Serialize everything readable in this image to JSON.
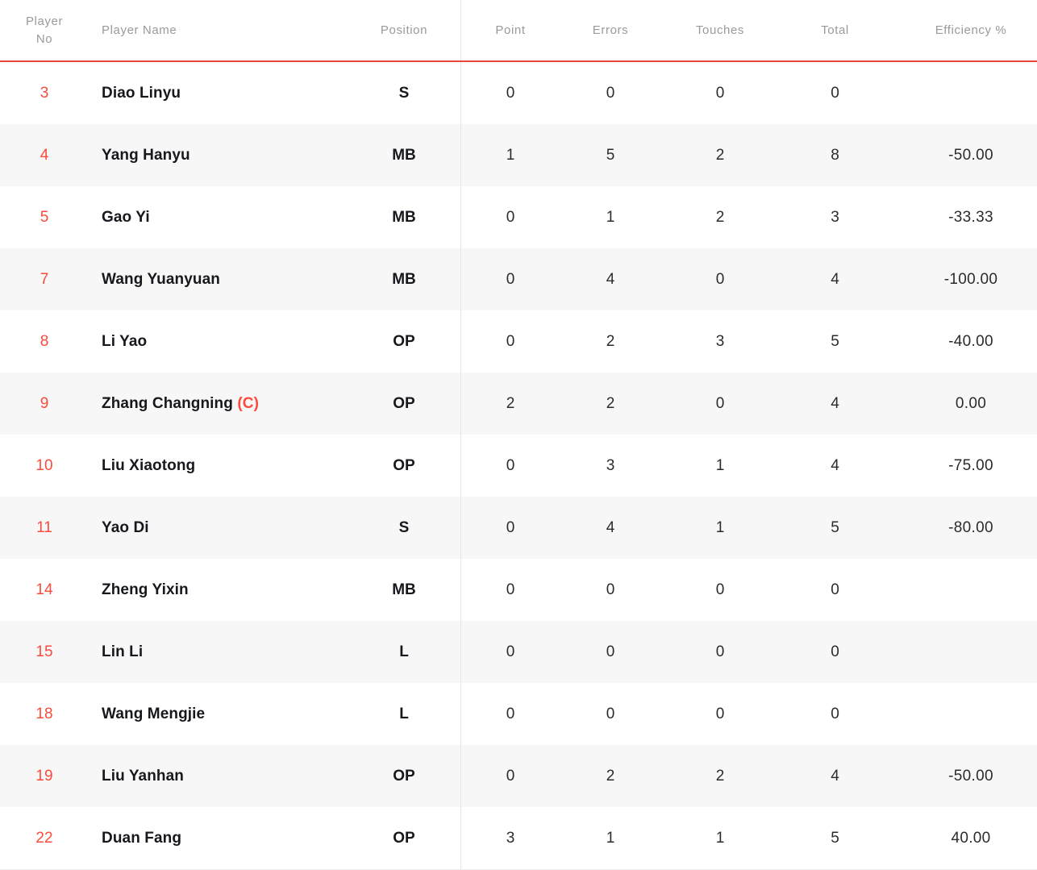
{
  "table": {
    "columns": [
      {
        "key": "player_no",
        "label": "Player No",
        "label_line1": "Player",
        "label_line2": "No"
      },
      {
        "key": "name",
        "label": "Player Name"
      },
      {
        "key": "position",
        "label": "Position"
      },
      {
        "key": "point",
        "label": "Point"
      },
      {
        "key": "errors",
        "label": "Errors"
      },
      {
        "key": "touches",
        "label": "Touches"
      },
      {
        "key": "total",
        "label": "Total"
      },
      {
        "key": "efficiency",
        "label": "Efficiency %"
      }
    ],
    "captain_marker": "(C)",
    "accent_color": "#fb4b3c",
    "header_rule_color": "#e8453c",
    "stripe_color": "#f7f7f7",
    "rows": [
      {
        "player_no": "3",
        "name": "Diao Linyu",
        "captain": "",
        "position": "S",
        "point": "0",
        "errors": "0",
        "touches": "0",
        "total": "0",
        "efficiency": ""
      },
      {
        "player_no": "4",
        "name": "Yang Hanyu",
        "captain": "",
        "position": "MB",
        "point": "1",
        "errors": "5",
        "touches": "2",
        "total": "8",
        "efficiency": "-50.00"
      },
      {
        "player_no": "5",
        "name": "Gao Yi",
        "captain": "",
        "position": "MB",
        "point": "0",
        "errors": "1",
        "touches": "2",
        "total": "3",
        "efficiency": "-33.33"
      },
      {
        "player_no": "7",
        "name": "Wang Yuanyuan",
        "captain": "",
        "position": "MB",
        "point": "0",
        "errors": "4",
        "touches": "0",
        "total": "4",
        "efficiency": "-100.00"
      },
      {
        "player_no": "8",
        "name": "Li Yao",
        "captain": "",
        "position": "OP",
        "point": "0",
        "errors": "2",
        "touches": "3",
        "total": "5",
        "efficiency": "-40.00"
      },
      {
        "player_no": "9",
        "name": "Zhang Changning",
        "captain": "(C)",
        "position": "OP",
        "point": "2",
        "errors": "2",
        "touches": "0",
        "total": "4",
        "efficiency": "0.00"
      },
      {
        "player_no": "10",
        "name": "Liu Xiaotong",
        "captain": "",
        "position": "OP",
        "point": "0",
        "errors": "3",
        "touches": "1",
        "total": "4",
        "efficiency": "-75.00"
      },
      {
        "player_no": "11",
        "name": "Yao Di",
        "captain": "",
        "position": "S",
        "point": "0",
        "errors": "4",
        "touches": "1",
        "total": "5",
        "efficiency": "-80.00"
      },
      {
        "player_no": "14",
        "name": "Zheng Yixin",
        "captain": "",
        "position": "MB",
        "point": "0",
        "errors": "0",
        "touches": "0",
        "total": "0",
        "efficiency": ""
      },
      {
        "player_no": "15",
        "name": "Lin Li",
        "captain": "",
        "position": "L",
        "point": "0",
        "errors": "0",
        "touches": "0",
        "total": "0",
        "efficiency": ""
      },
      {
        "player_no": "18",
        "name": "Wang Mengjie",
        "captain": "",
        "position": "L",
        "point": "0",
        "errors": "0",
        "touches": "0",
        "total": "0",
        "efficiency": ""
      },
      {
        "player_no": "19",
        "name": "Liu Yanhan",
        "captain": "",
        "position": "OP",
        "point": "0",
        "errors": "2",
        "touches": "2",
        "total": "4",
        "efficiency": "-50.00"
      },
      {
        "player_no": "22",
        "name": "Duan Fang",
        "captain": "",
        "position": "OP",
        "point": "3",
        "errors": "1",
        "touches": "1",
        "total": "5",
        "efficiency": "40.00"
      }
    ]
  }
}
